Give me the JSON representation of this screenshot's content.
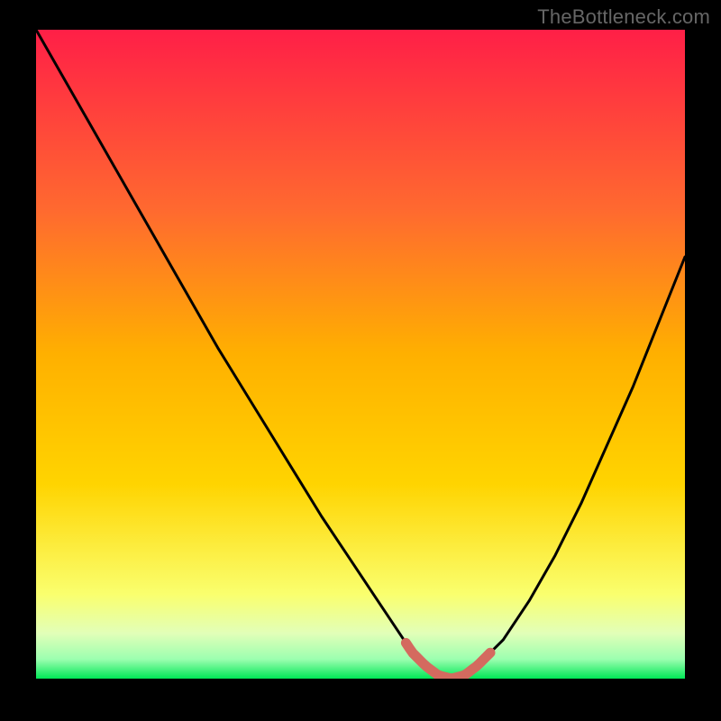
{
  "watermark": "TheBottleneck.com",
  "colors": {
    "bg": "#000000",
    "watermark": "#666666",
    "curve": "#000000",
    "marker": "#d46a5f",
    "gradient_top": "#ff1f47",
    "gradient_mid_upper": "#ff8a2a",
    "gradient_mid": "#ffd400",
    "gradient_mid_lower": "#f7ff63",
    "gradient_band": "#e6ffc0",
    "gradient_bottom": "#00e756"
  },
  "chart_data": {
    "type": "line",
    "title": "",
    "xlabel": "",
    "ylabel": "",
    "xlim": [
      0,
      100
    ],
    "ylim": [
      0,
      100
    ],
    "x": [
      0,
      4,
      8,
      12,
      16,
      20,
      24,
      28,
      32,
      36,
      40,
      44,
      48,
      52,
      56,
      58,
      60,
      62,
      64,
      66,
      68,
      72,
      76,
      80,
      84,
      88,
      92,
      96,
      100
    ],
    "values": [
      100,
      93,
      86,
      79,
      72,
      65,
      58,
      51,
      44.5,
      38,
      31.5,
      25,
      19,
      13,
      7,
      4,
      2,
      0.5,
      0,
      0.5,
      2,
      6,
      12,
      19,
      27,
      36,
      45,
      55,
      65
    ],
    "marker_range_x": [
      57,
      70
    ],
    "grid": false,
    "legend": null
  }
}
